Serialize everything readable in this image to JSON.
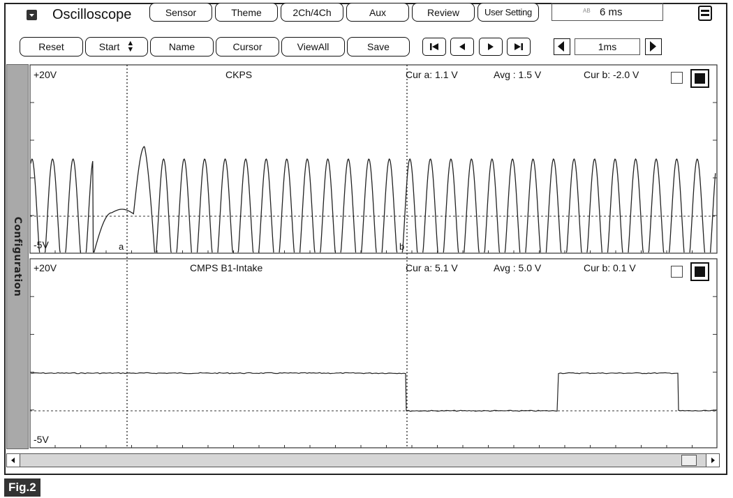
{
  "app": {
    "title": "Oscilloscope",
    "figure_label": "Fig.2"
  },
  "toolbar_top": {
    "buttons": [
      "Sensor",
      "Theme",
      "2Ch/4Ch",
      "Aux",
      "Review",
      "User Setting"
    ],
    "time_icon": "AB",
    "time_value": "6 ms"
  },
  "toolbar_second": {
    "buttons": [
      "Reset",
      "Start",
      "Name",
      "Cursor",
      "ViewAll",
      "Save"
    ],
    "nav_icons": [
      "skip-to-start-icon",
      "step-back-icon",
      "step-forward-icon",
      "skip-to-end-icon"
    ],
    "timebase": "1ms"
  },
  "sidebar": {
    "label": "Configuration"
  },
  "channels": [
    {
      "name": "CKPS",
      "top_label": "+20V",
      "bottom_label": "-5V",
      "cur_a": "Cur a: 1.1 V",
      "avg": "Avg  : 1.5 V",
      "cur_b": "Cur b: -2.0 V",
      "cursor_a_marker": "a",
      "cursor_b_marker": "b"
    },
    {
      "name": "CMPS B1-Intake",
      "top_label": "+20V",
      "bottom_label": "-5V",
      "cur_a": "Cur a: 5.1 V",
      "avg": "Avg  : 5.0 V",
      "cur_b": "Cur b: 0.1 V"
    }
  ],
  "colors": {
    "trace": "#222222",
    "grid": "#333333",
    "sidebar": "#a9a9a9",
    "fig_label_bg": "#333333"
  }
}
